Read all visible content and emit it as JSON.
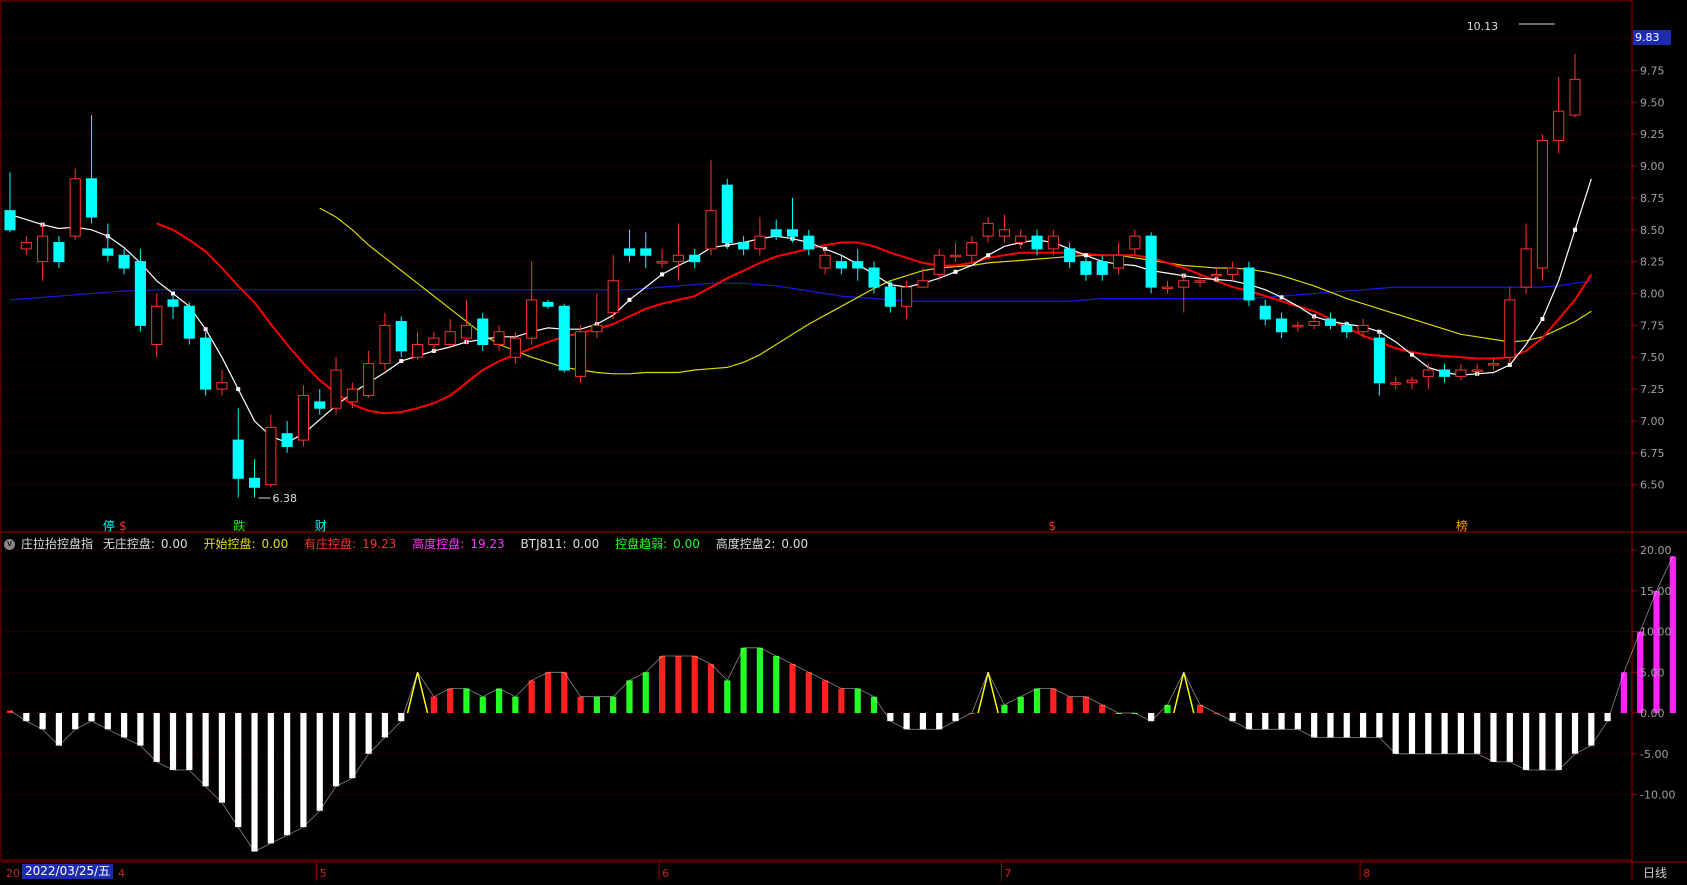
{
  "colors": {
    "up": "#ff3030",
    "down": "#00ffff",
    "ma_white": "#ffffff",
    "ma_red": "#ff0000",
    "ma_yellow": "#d8d800",
    "ma_blue": "#1a1adc",
    "grid": "#7a0000",
    "axis_text": "#a0a0a0",
    "price_tag_bg": "#1c2bb0"
  },
  "price_panel": {
    "current_price": "9.83",
    "high_label": "10.13",
    "low_label": "6.38"
  },
  "markers": [
    {
      "i": 6,
      "text": "停",
      "color": "#00ffff"
    },
    {
      "i": 7,
      "text": "$",
      "color": "#ff3030"
    },
    {
      "i": 14,
      "text": "跌",
      "color": "#00ff00"
    },
    {
      "i": 19,
      "text": "财",
      "color": "#00ffff"
    },
    {
      "i": 64,
      "text": "$",
      "color": "#ff3030"
    },
    {
      "i": 89,
      "text": "榜",
      "color": "#ff9900"
    }
  ],
  "indicator": {
    "name": "庄拉抬控盘指",
    "items": [
      {
        "label": "无庄控盘:",
        "value": "0.00",
        "color": "#dddddd"
      },
      {
        "label": "开始控盘:",
        "value": "0.00",
        "color": "#e0e000"
      },
      {
        "label": "有庄控盘:",
        "value": "19.23",
        "color": "#ff3030"
      },
      {
        "label": "高度控盘:",
        "value": "19.23",
        "color": "#ff33ff"
      },
      {
        "label": "BTJ811:",
        "value": "0.00",
        "color": "#dddddd"
      },
      {
        "label": "控盘趋弱:",
        "value": "0.00",
        "color": "#22ff22"
      },
      {
        "label": "高度控盘2:",
        "value": "0.00",
        "color": "#dddddd"
      }
    ]
  },
  "footer": {
    "date": "2022/03/25/五",
    "period": "日线",
    "month_labels": [
      "5",
      "6",
      "7",
      "8"
    ],
    "left_fragment": "20",
    "left_fragment2": "4"
  },
  "chart_data": [
    {
      "type": "candlestick",
      "title": "",
      "ylim": [
        6.38,
        10.13
      ],
      "y_ticks": [
        10.0,
        9.75,
        9.5,
        9.25,
        9.0,
        8.75,
        8.5,
        8.25,
        8.0,
        7.75,
        7.5,
        7.25,
        7.0,
        6.75,
        6.5
      ],
      "y_tick_labels": [
        "10.00",
        "9.75",
        "9.50",
        "9.25",
        "9.00",
        "8.75",
        "8.50",
        "8.25",
        "8.00",
        "7.75",
        "7.50",
        "7.25",
        "7.00",
        "6.75",
        "6.50"
      ],
      "candles": [
        [
          8.65,
          8.5,
          8.95,
          8.48
        ],
        [
          8.35,
          8.4,
          8.45,
          8.3
        ],
        [
          8.25,
          8.45,
          8.55,
          8.1
        ],
        [
          8.4,
          8.25,
          8.45,
          8.2
        ],
        [
          8.45,
          8.9,
          8.98,
          8.42
        ],
        [
          8.9,
          8.6,
          9.4,
          8.55
        ],
        [
          8.35,
          8.3,
          8.55,
          8.25
        ],
        [
          8.3,
          8.2,
          8.35,
          8.15
        ],
        [
          8.25,
          7.75,
          8.35,
          7.7
        ],
        [
          7.6,
          7.9,
          8.0,
          7.5
        ],
        [
          7.95,
          7.9,
          7.98,
          7.8
        ],
        [
          7.9,
          7.65,
          7.93,
          7.6
        ],
        [
          7.65,
          7.25,
          7.7,
          7.2
        ],
        [
          7.25,
          7.3,
          7.4,
          7.2
        ],
        [
          6.85,
          6.55,
          7.1,
          6.4
        ],
        [
          6.55,
          6.48,
          6.7,
          6.4
        ],
        [
          6.5,
          6.95,
          7.05,
          6.48
        ],
        [
          6.9,
          6.8,
          7.0,
          6.75
        ],
        [
          6.85,
          7.2,
          7.28,
          6.8
        ],
        [
          7.15,
          7.1,
          7.25,
          7.05
        ],
        [
          7.1,
          7.4,
          7.5,
          7.05
        ],
        [
          7.15,
          7.25,
          7.3,
          7.1
        ],
        [
          7.2,
          7.45,
          7.55,
          7.18
        ],
        [
          7.45,
          7.75,
          7.85,
          7.4
        ],
        [
          7.78,
          7.55,
          7.82,
          7.5
        ],
        [
          7.5,
          7.6,
          7.7,
          7.48
        ],
        [
          7.6,
          7.65,
          7.7,
          7.55
        ],
        [
          7.6,
          7.7,
          7.8,
          7.58
        ],
        [
          7.65,
          7.75,
          7.95,
          7.6
        ],
        [
          7.8,
          7.6,
          7.85,
          7.55
        ],
        [
          7.6,
          7.7,
          7.75,
          7.55
        ],
        [
          7.5,
          7.65,
          7.7,
          7.45
        ],
        [
          7.65,
          7.95,
          8.25,
          7.6
        ],
        [
          7.93,
          7.9,
          7.95,
          7.88
        ],
        [
          7.9,
          7.4,
          7.92,
          7.38
        ],
        [
          7.35,
          7.7,
          7.75,
          7.3
        ],
        [
          7.7,
          7.75,
          8.0,
          7.65
        ],
        [
          7.85,
          8.1,
          8.3,
          7.8
        ],
        [
          8.35,
          8.3,
          8.5,
          8.25
        ],
        [
          8.35,
          8.3,
          8.48,
          8.2
        ],
        [
          8.25,
          8.25,
          8.35,
          8.2
        ],
        [
          8.25,
          8.3,
          8.55,
          8.1
        ],
        [
          8.3,
          8.25,
          8.35,
          8.2
        ],
        [
          8.35,
          8.65,
          9.05,
          8.3
        ],
        [
          8.85,
          8.4,
          8.9,
          8.35
        ],
        [
          8.4,
          8.35,
          8.45,
          8.3
        ],
        [
          8.35,
          8.45,
          8.6,
          8.3
        ],
        [
          8.5,
          8.45,
          8.58,
          8.42
        ],
        [
          8.5,
          8.45,
          8.75,
          8.4
        ],
        [
          8.45,
          8.35,
          8.5,
          8.3
        ],
        [
          8.2,
          8.3,
          8.35,
          8.15
        ],
        [
          8.25,
          8.2,
          8.3,
          8.15
        ],
        [
          8.25,
          8.2,
          8.35,
          8.1
        ],
        [
          8.2,
          8.05,
          8.25,
          8.0
        ],
        [
          8.05,
          7.9,
          8.1,
          7.85
        ],
        [
          7.9,
          8.05,
          8.1,
          7.8
        ],
        [
          8.05,
          8.1,
          8.2,
          8.05
        ],
        [
          8.15,
          8.3,
          8.35,
          8.1
        ],
        [
          8.3,
          8.3,
          8.4,
          8.25
        ],
        [
          8.3,
          8.4,
          8.45,
          8.25
        ],
        [
          8.45,
          8.55,
          8.6,
          8.4
        ],
        [
          8.45,
          8.5,
          8.62,
          8.4
        ],
        [
          8.4,
          8.45,
          8.5,
          8.35
        ],
        [
          8.45,
          8.35,
          8.5,
          8.3
        ],
        [
          8.35,
          8.45,
          8.5,
          8.3
        ],
        [
          8.35,
          8.25,
          8.4,
          8.2
        ],
        [
          8.25,
          8.15,
          8.28,
          8.1
        ],
        [
          8.25,
          8.15,
          8.3,
          8.1
        ],
        [
          8.2,
          8.3,
          8.4,
          8.15
        ],
        [
          8.35,
          8.45,
          8.5,
          8.3
        ],
        [
          8.45,
          8.05,
          8.48,
          8.0
        ],
        [
          8.05,
          8.05,
          8.1,
          8.0
        ],
        [
          8.05,
          8.1,
          8.15,
          7.85
        ],
        [
          8.1,
          8.1,
          8.15,
          8.05
        ],
        [
          8.15,
          8.15,
          8.2,
          8.1
        ],
        [
          8.15,
          8.2,
          8.25,
          8.1
        ],
        [
          8.2,
          7.95,
          8.25,
          7.9
        ],
        [
          7.9,
          7.8,
          7.95,
          7.75
        ],
        [
          7.8,
          7.7,
          7.85,
          7.65
        ],
        [
          7.75,
          7.75,
          7.78,
          7.7
        ],
        [
          7.75,
          7.78,
          7.82,
          7.72
        ],
        [
          7.8,
          7.75,
          7.85,
          7.72
        ],
        [
          7.75,
          7.7,
          7.78,
          7.65
        ],
        [
          7.7,
          7.75,
          7.8,
          7.65
        ],
        [
          7.65,
          7.3,
          7.7,
          7.2
        ],
        [
          7.3,
          7.3,
          7.35,
          7.25
        ],
        [
          7.3,
          7.32,
          7.35,
          7.25
        ],
        [
          7.35,
          7.4,
          7.45,
          7.25
        ],
        [
          7.4,
          7.35,
          7.45,
          7.3
        ],
        [
          7.35,
          7.4,
          7.45,
          7.32
        ],
        [
          7.4,
          7.4,
          7.45,
          7.35
        ],
        [
          7.45,
          7.45,
          7.5,
          7.4
        ],
        [
          7.5,
          7.95,
          8.05,
          7.45
        ],
        [
          8.05,
          8.35,
          8.55,
          8.0
        ],
        [
          8.2,
          9.2,
          9.25,
          8.1
        ],
        [
          9.2,
          9.43,
          9.7,
          9.1
        ],
        [
          9.4,
          9.68,
          9.88,
          9.38
        ]
      ],
      "ma_white": [
        8.62,
        8.58,
        8.54,
        8.51,
        8.52,
        8.5,
        8.45,
        8.36,
        8.24,
        8.1,
        8.0,
        7.9,
        7.72,
        7.5,
        7.25,
        7.0,
        6.88,
        6.83,
        6.9,
        7.01,
        7.12,
        7.22,
        7.3,
        7.38,
        7.47,
        7.51,
        7.55,
        7.58,
        7.62,
        7.64,
        7.66,
        7.66,
        7.7,
        7.73,
        7.72,
        7.72,
        7.76,
        7.83,
        7.95,
        8.05,
        8.15,
        8.22,
        8.28,
        8.36,
        8.38,
        8.4,
        8.43,
        8.45,
        8.43,
        8.4,
        8.35,
        8.3,
        8.23,
        8.15,
        8.07,
        8.05,
        8.08,
        8.12,
        8.17,
        8.22,
        8.3,
        8.37,
        8.4,
        8.42,
        8.4,
        8.35,
        8.3,
        8.25,
        8.23,
        8.22,
        8.18,
        8.16,
        8.14,
        8.12,
        8.11,
        8.1,
        8.07,
        8.03,
        7.97,
        7.9,
        7.82,
        7.78,
        7.76,
        7.74,
        7.7,
        7.62,
        7.52,
        7.42,
        7.38,
        7.36,
        7.37,
        7.38,
        7.44,
        7.6,
        7.8,
        8.1,
        8.5,
        8.9
      ],
      "ma_red": [
        null,
        null,
        null,
        null,
        null,
        null,
        null,
        null,
        null,
        8.55,
        8.5,
        8.42,
        8.33,
        8.2,
        8.06,
        7.93,
        7.76,
        7.6,
        7.45,
        7.32,
        7.22,
        7.13,
        7.08,
        7.06,
        7.07,
        7.1,
        7.14,
        7.2,
        7.3,
        7.4,
        7.47,
        7.52,
        7.57,
        7.62,
        7.66,
        7.69,
        7.72,
        7.76,
        7.82,
        7.88,
        7.92,
        7.95,
        7.98,
        8.05,
        8.12,
        8.18,
        8.24,
        8.29,
        8.32,
        8.35,
        8.38,
        8.4,
        8.4,
        8.37,
        8.32,
        8.28,
        8.24,
        8.22,
        8.22,
        8.24,
        8.28,
        8.3,
        8.32,
        8.32,
        8.32,
        8.32,
        8.31,
        8.3,
        8.3,
        8.3,
        8.28,
        8.24,
        8.2,
        8.15,
        8.1,
        8.05,
        8.02,
        7.98,
        7.94,
        7.9,
        7.86,
        7.8,
        7.73,
        7.67,
        7.62,
        7.57,
        7.54,
        7.52,
        7.51,
        7.5,
        7.49,
        7.49,
        7.5,
        7.55,
        7.65,
        7.8,
        7.95,
        8.15
      ],
      "ma_yellow": [
        null,
        null,
        null,
        null,
        null,
        null,
        null,
        null,
        null,
        null,
        null,
        null,
        null,
        null,
        null,
        null,
        null,
        null,
        null,
        8.67,
        8.6,
        8.5,
        8.38,
        8.28,
        8.18,
        8.08,
        7.98,
        7.88,
        7.78,
        7.68,
        7.6,
        7.55,
        7.5,
        7.46,
        7.42,
        7.4,
        7.38,
        7.37,
        7.37,
        7.38,
        7.38,
        7.38,
        7.4,
        7.41,
        7.42,
        7.46,
        7.52,
        7.6,
        7.68,
        7.76,
        7.83,
        7.9,
        7.97,
        8.04,
        8.1,
        8.14,
        8.18,
        8.2,
        8.21,
        8.22,
        8.24,
        8.25,
        8.26,
        8.27,
        8.28,
        8.29,
        8.3,
        8.3,
        8.3,
        8.28,
        8.26,
        8.24,
        8.22,
        8.21,
        8.2,
        8.2,
        8.19,
        8.17,
        8.14,
        8.1,
        8.06,
        8.01,
        7.96,
        7.92,
        7.88,
        7.84,
        7.8,
        7.76,
        7.72,
        7.68,
        7.66,
        7.64,
        7.62,
        7.63,
        7.66,
        7.72,
        7.78,
        7.86
      ],
      "ma_blue": [
        7.95,
        7.96,
        7.97,
        7.98,
        7.99,
        8.0,
        8.01,
        8.02,
        8.02,
        8.03,
        8.03,
        8.03,
        8.03,
        8.03,
        8.03,
        8.03,
        8.03,
        8.03,
        8.03,
        8.03,
        8.03,
        8.03,
        8.03,
        8.03,
        8.03,
        8.03,
        8.03,
        8.03,
        8.03,
        8.03,
        8.03,
        8.03,
        8.03,
        8.03,
        8.03,
        8.03,
        8.03,
        8.03,
        8.03,
        8.04,
        8.05,
        8.06,
        8.07,
        8.08,
        8.08,
        8.08,
        8.07,
        8.06,
        8.04,
        8.02,
        8.0,
        7.98,
        7.97,
        7.96,
        7.95,
        7.94,
        7.94,
        7.94,
        7.94,
        7.94,
        7.94,
        7.94,
        7.94,
        7.94,
        7.94,
        7.94,
        7.95,
        7.96,
        7.96,
        7.96,
        7.96,
        7.96,
        7.96,
        7.96,
        7.96,
        7.96,
        7.96,
        7.97,
        7.98,
        7.99,
        8.0,
        8.01,
        8.02,
        8.03,
        8.04,
        8.05,
        8.05,
        8.05,
        8.05,
        8.05,
        8.05,
        8.05,
        8.05,
        8.05,
        8.05,
        8.06,
        8.08,
        8.1
      ]
    },
    {
      "type": "bar",
      "title": "庄拉抬控盘指",
      "ylim": [
        -18,
        21
      ],
      "y_ticks": [
        20,
        15,
        10,
        5,
        0,
        -5,
        -10
      ],
      "y_tick_labels": [
        "20.00",
        "15.00",
        "10.00",
        "5.00",
        "0.00",
        "-5.00",
        "-10.00"
      ],
      "values": [
        0.3,
        -1,
        -2,
        -4,
        -2,
        -1,
        -2,
        -3,
        -4,
        -6,
        -7,
        -7,
        -9,
        -11,
        -14,
        -17,
        -16,
        -15,
        -14,
        -12,
        -9,
        -8,
        -5,
        -3,
        -1,
        5,
        2,
        3,
        3,
        2,
        3,
        2,
        4,
        5,
        5,
        2,
        2,
        2,
        4,
        5,
        7,
        7,
        7,
        6,
        4,
        8,
        8,
        7,
        6,
        5,
        4,
        3,
        3,
        2,
        -1,
        -2,
        -2,
        -2,
        -1,
        0,
        5,
        1,
        2,
        3,
        3,
        2,
        2,
        1,
        0,
        0,
        -1,
        1,
        5,
        1,
        0,
        -1,
        -2,
        -2,
        -2,
        -2,
        -3,
        -3,
        -3,
        -3,
        -3,
        -5,
        -5,
        -5,
        -5,
        -5,
        -5,
        -6,
        -6,
        -7,
        -7,
        -7,
        -5,
        -4,
        -1,
        5,
        10,
        15,
        19.23
      ]
    }
  ]
}
